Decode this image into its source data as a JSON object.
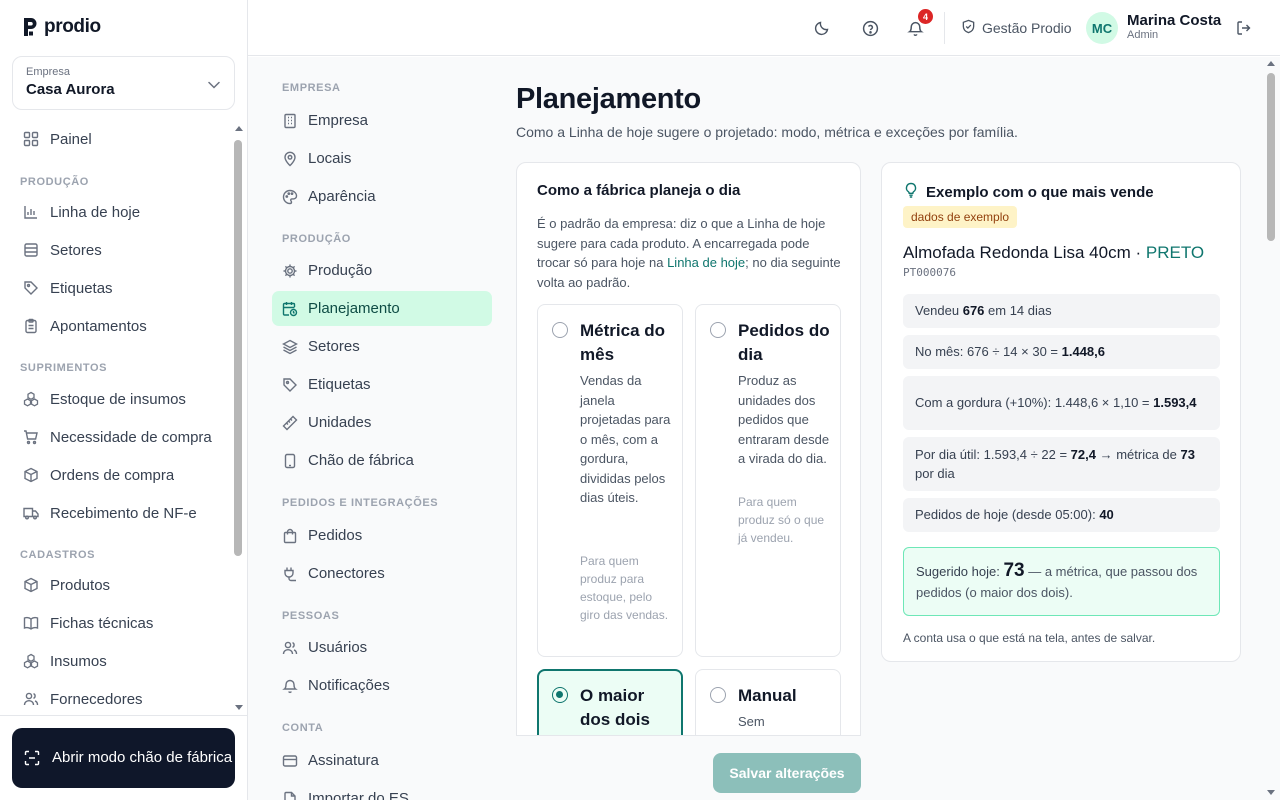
{
  "brand": {
    "name": "prodio"
  },
  "company": {
    "label": "Empresa",
    "value": "Casa Aurora"
  },
  "sidebar": {
    "items": [
      {
        "label": "Painel",
        "icon": "grid-icon"
      },
      {
        "section": "PRODUÇÃO"
      },
      {
        "label": "Linha de hoje",
        "icon": "chart-icon"
      },
      {
        "label": "Setores",
        "icon": "list-icon"
      },
      {
        "label": "Etiquetas",
        "icon": "tag-icon"
      },
      {
        "label": "Apontamentos",
        "icon": "clipboard-icon"
      },
      {
        "section": "SUPRIMENTOS"
      },
      {
        "label": "Estoque de insumos",
        "icon": "boxes-icon"
      },
      {
        "label": "Necessidade de compra",
        "icon": "cart-icon"
      },
      {
        "label": "Ordens de compra",
        "icon": "package-icon"
      },
      {
        "label": "Recebimento de NF-e",
        "icon": "truck-icon"
      },
      {
        "section": "CADASTROS"
      },
      {
        "label": "Produtos",
        "icon": "package-icon"
      },
      {
        "label": "Fichas técnicas",
        "icon": "book-icon"
      },
      {
        "label": "Insumos",
        "icon": "boxes-icon"
      },
      {
        "label": "Fornecedores",
        "icon": "users-icon"
      }
    ],
    "floor_button": "Abrir modo chão de fábrica"
  },
  "topbar": {
    "notification_count": "4",
    "workspace": "Gestão Prodio",
    "user": {
      "initials": "MC",
      "name": "Marina Costa",
      "role": "Admin"
    }
  },
  "settings_nav": {
    "sections": [
      {
        "title": "EMPRESA",
        "items": [
          "Empresa",
          "Locais",
          "Aparência"
        ]
      },
      {
        "title": "PRODUÇÃO",
        "items": [
          "Produção",
          "Planejamento",
          "Setores",
          "Etiquetas",
          "Unidades",
          "Chão de fábrica"
        ]
      },
      {
        "title": "PEDIDOS E INTEGRAÇÕES",
        "items": [
          "Pedidos",
          "Conectores"
        ]
      },
      {
        "title": "PESSOAS",
        "items": [
          "Usuários",
          "Notificações"
        ]
      },
      {
        "title": "CONTA",
        "items": [
          "Assinatura",
          "Importar do ES"
        ]
      }
    ],
    "active": "Planejamento"
  },
  "page": {
    "title": "Planejamento",
    "subtitle": "Como a Linha de hoje sugere o projetado: modo, métrica e exceções por família."
  },
  "planning_card": {
    "title": "Como a fábrica planeja o dia",
    "desc_before": "É o padrão da empresa: diz o que a Linha de hoje sugere para cada produto. A encarregada pode trocar só para hoje na ",
    "desc_link": "Linha de hoje",
    "desc_after": "; no dia seguinte volta ao padrão.",
    "options": [
      {
        "title": "Métrica do mês",
        "desc": "Vendas da janela projetadas para o mês, com a gordura, divididas pelos dias úteis.",
        "note": "Para quem produz para estoque, pelo giro das vendas.",
        "selected": false
      },
      {
        "title": "Pedidos do dia",
        "desc": "Produz as unidades dos pedidos que entraram desde a virada do dia.",
        "note": "Para quem produz só o que já vendeu.",
        "selected": false
      },
      {
        "title": "O maior dos dois",
        "desc": "",
        "note": "",
        "selected": true
      },
      {
        "title": "Manual",
        "desc": "Sem",
        "note": "",
        "selected": false
      }
    ],
    "save_label": "Salvar alterações"
  },
  "example_card": {
    "title": "Exemplo com o que mais vende",
    "pill": "dados de exemplo",
    "product": "Almofada Redonda Lisa 40cm",
    "separator": " · ",
    "color": "PRETO",
    "code": "PT000076",
    "rows": {
      "r1": {
        "a": "Vendeu ",
        "b": "676",
        "c": " em 14 dias"
      },
      "r2": {
        "a": "No mês: 676 ÷ 14 × 30 = ",
        "b": "1.448,6"
      },
      "r3": {
        "a": "Com a gordura (+10%): 1.448,6 × 1,10 = ",
        "b": "1.593,4"
      },
      "r4": {
        "a": "Por dia útil: 1.593,4 ÷ 22 = ",
        "b": "72,4",
        "c": " → métrica de ",
        "d": "73",
        "e": " por dia"
      },
      "r5": {
        "a": "Pedidos de hoje (desde 05:00): ",
        "b": "40"
      }
    },
    "suggest": {
      "label": "Sugerido hoje: ",
      "value": "73",
      "text": " — a métrica, que passou dos pedidos (o maior dos dois)."
    },
    "footer": "A conta usa o que está na tela, antes de salvar."
  },
  "colors": {
    "accent": "#0f766e",
    "active_bg": "#d1fae5",
    "dark": "#0f172a",
    "badge": "#dc2626"
  }
}
